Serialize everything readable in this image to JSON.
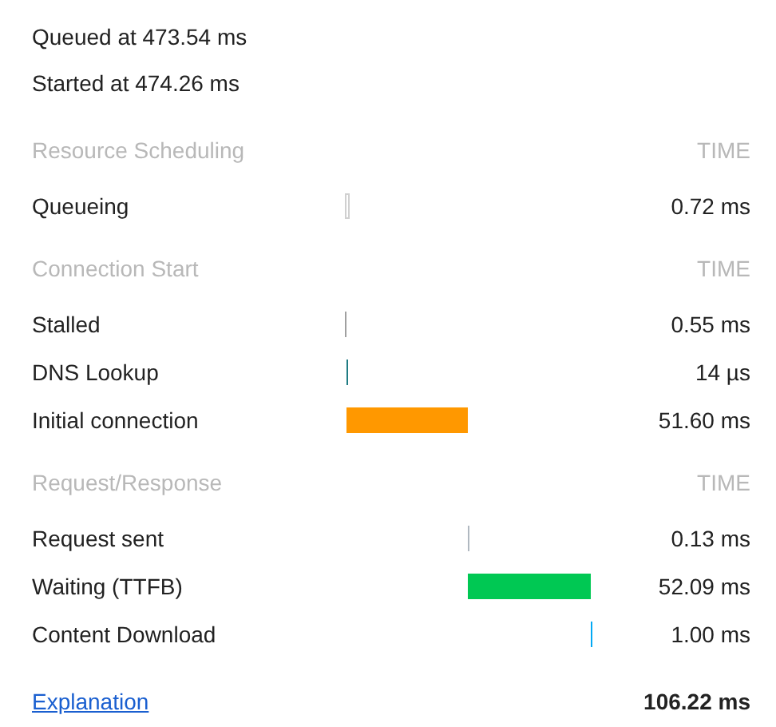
{
  "events": [
    "Queued at 473.54 ms",
    "Started at 474.26 ms"
  ],
  "sections": [
    {
      "title": "Resource Scheduling",
      "time_heading": "TIME",
      "rows": [
        {
          "label": "Queueing",
          "value": "0.72 ms",
          "color": "#d0d0d0"
        }
      ]
    },
    {
      "title": "Connection Start",
      "time_heading": "TIME",
      "rows": [
        {
          "label": "Stalled",
          "value": "0.55 ms",
          "color": "#a0a0a0"
        },
        {
          "label": "DNS Lookup",
          "value": "14 µs",
          "color": "#1f7c83"
        },
        {
          "label": "Initial connection",
          "value": "51.60 ms",
          "color": "#ff9800"
        }
      ]
    },
    {
      "title": "Request/Response",
      "time_heading": "TIME",
      "rows": [
        {
          "label": "Request sent",
          "value": "0.13 ms",
          "color": "#b0b8c0"
        },
        {
          "label": "Waiting (TTFB)",
          "value": "52.09 ms",
          "color": "#00c853"
        },
        {
          "label": "Content Download",
          "value": "1.00 ms",
          "color": "#03a9f4"
        }
      ]
    }
  ],
  "footer": {
    "link": "Explanation",
    "total": "106.22 ms"
  }
}
